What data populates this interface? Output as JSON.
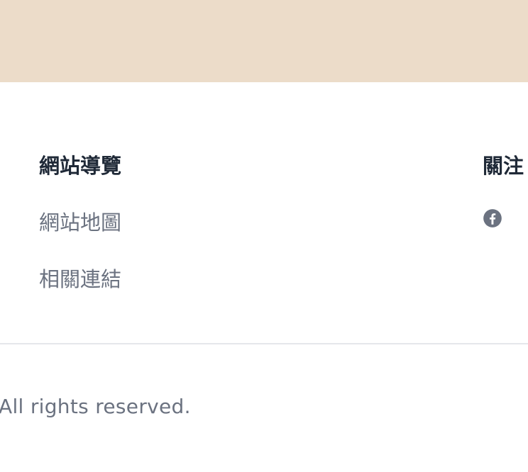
{
  "colors": {
    "top_band": "#ecdcc9",
    "heading": "#1f2937",
    "link": "#6b7280",
    "divider": "#e5e7eb"
  },
  "footer": {
    "nav": {
      "heading": "網站導覽",
      "links": [
        {
          "label": "網站地圖"
        },
        {
          "label": "相關連結"
        }
      ]
    },
    "follow": {
      "heading": "關注我們",
      "visible_heading": "關注",
      "icons": [
        "facebook-icon"
      ]
    },
    "copyright": "All rights reserved."
  }
}
